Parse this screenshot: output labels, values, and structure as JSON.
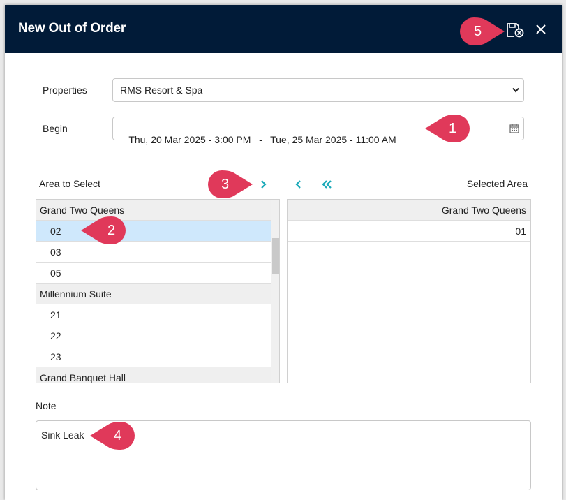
{
  "dialog": {
    "title": "New Out of Order",
    "save_icon": "save-cancel-icon",
    "close_icon": "close-icon"
  },
  "form": {
    "properties_label": "Properties",
    "properties_value": "RMS Resort & Spa",
    "begin_label": "Begin",
    "date_range": "Thu, 20 Mar 2025 - 3:00 PM   -   Tue, 25 Mar 2025 - 11:00 AM"
  },
  "area": {
    "available_label": "Area to Select",
    "selected_label": "Selected Area",
    "available": [
      {
        "label": "Grand Two Queens",
        "type": "group"
      },
      {
        "label": "02",
        "type": "item",
        "selected": true
      },
      {
        "label": "03",
        "type": "item"
      },
      {
        "label": "05",
        "type": "item"
      },
      {
        "label": "Millennium Suite",
        "type": "group"
      },
      {
        "label": "21",
        "type": "item"
      },
      {
        "label": "22",
        "type": "item"
      },
      {
        "label": "23",
        "type": "item"
      },
      {
        "label": "Grand Banquet Hall",
        "type": "group"
      }
    ],
    "selected": [
      {
        "label": "Grand Two Queens",
        "type": "group"
      },
      {
        "label": "01",
        "type": "item"
      }
    ]
  },
  "note": {
    "label": "Note",
    "value": "Sink Leak"
  },
  "callouts": [
    "1",
    "2",
    "3",
    "4",
    "5"
  ],
  "colors": {
    "header_bg": "#011b38",
    "accent_teal": "#1aa9b8",
    "callout": "#e0395a",
    "selected_row": "#cfe8fc"
  }
}
